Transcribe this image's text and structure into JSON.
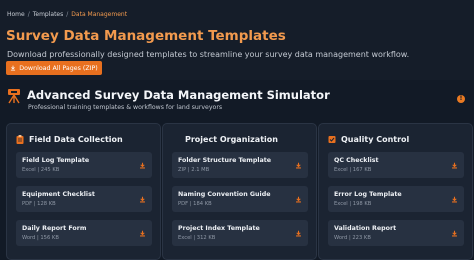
{
  "breadcrumb": {
    "home": "Home",
    "templates": "Templates",
    "current": "Data Management"
  },
  "page_title": "Survey Data Management Templates",
  "subtitle": "Download professionally designed templates to streamline your survey data management workflow.",
  "download_all_label": "Download All Pages (ZIP)",
  "simulator": {
    "title": "Advanced Survey Data Management Simulator",
    "subtitle": "Professional training templates & workflows for land surveyors",
    "info_badge": "!"
  },
  "columns": [
    {
      "title": "Field Data Collection",
      "icon": "clipboard-icon",
      "items": [
        {
          "name": "Field Log Template",
          "meta": "Excel | 245 KB"
        },
        {
          "name": "Equipment Checklist",
          "meta": "PDF | 128 KB"
        },
        {
          "name": "Daily Report Form",
          "meta": "Word | 156 KB"
        }
      ]
    },
    {
      "title": "Project Organization",
      "icon": "folder-icon",
      "items": [
        {
          "name": "Folder Structure Template",
          "meta": "ZIP | 2.1 MB"
        },
        {
          "name": "Naming Convention Guide",
          "meta": "PDF | 184 KB"
        },
        {
          "name": "Project Index Template",
          "meta": "Excel | 312 KB"
        }
      ]
    },
    {
      "title": "Quality Control",
      "icon": "check-icon",
      "items": [
        {
          "name": "QC Checklist",
          "meta": "Excel | 167 KB"
        },
        {
          "name": "Error Log Template",
          "meta": "Excel | 198 KB"
        },
        {
          "name": "Validation Report",
          "meta": "Word | 223 KB"
        }
      ]
    }
  ],
  "colors": {
    "accent": "#e8701f",
    "title_orange": "#f29a4e",
    "background": "#121a26",
    "card": "#273141"
  }
}
